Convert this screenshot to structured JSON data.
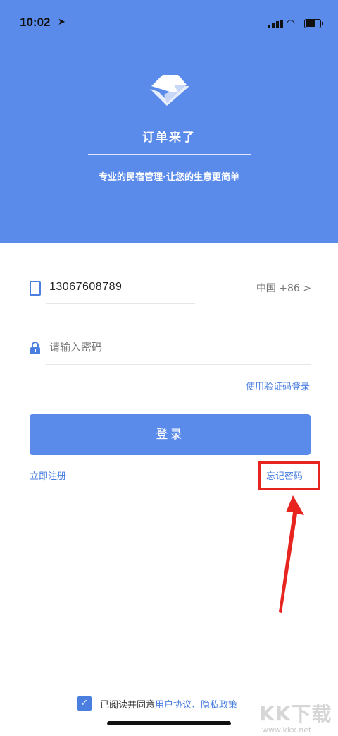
{
  "status_bar": {
    "time": "10:02",
    "location_icon": "location-arrow-icon",
    "battery_level": 0.75
  },
  "hero": {
    "app_name": "订单来了",
    "tagline": "专业的民宿管理·让您的生意更简单"
  },
  "phone": {
    "value": "13067608789",
    "region": "中国 +86 >"
  },
  "password": {
    "placeholder": "请输入密码"
  },
  "links": {
    "code_login": "使用验证码登录",
    "register": "立即注册",
    "forgot": "忘记密码"
  },
  "login_button": {
    "label": "登录"
  },
  "agreement": {
    "check": "✓",
    "prefix": "已阅读并同意",
    "terms": "用户协议、隐私政策"
  },
  "watermark": {
    "main": "KK下载",
    "url": "www.kkx.net"
  },
  "colors": {
    "brand": "#5a8bea",
    "accent": "#4a7fe0",
    "highlight": "#e8241f"
  }
}
